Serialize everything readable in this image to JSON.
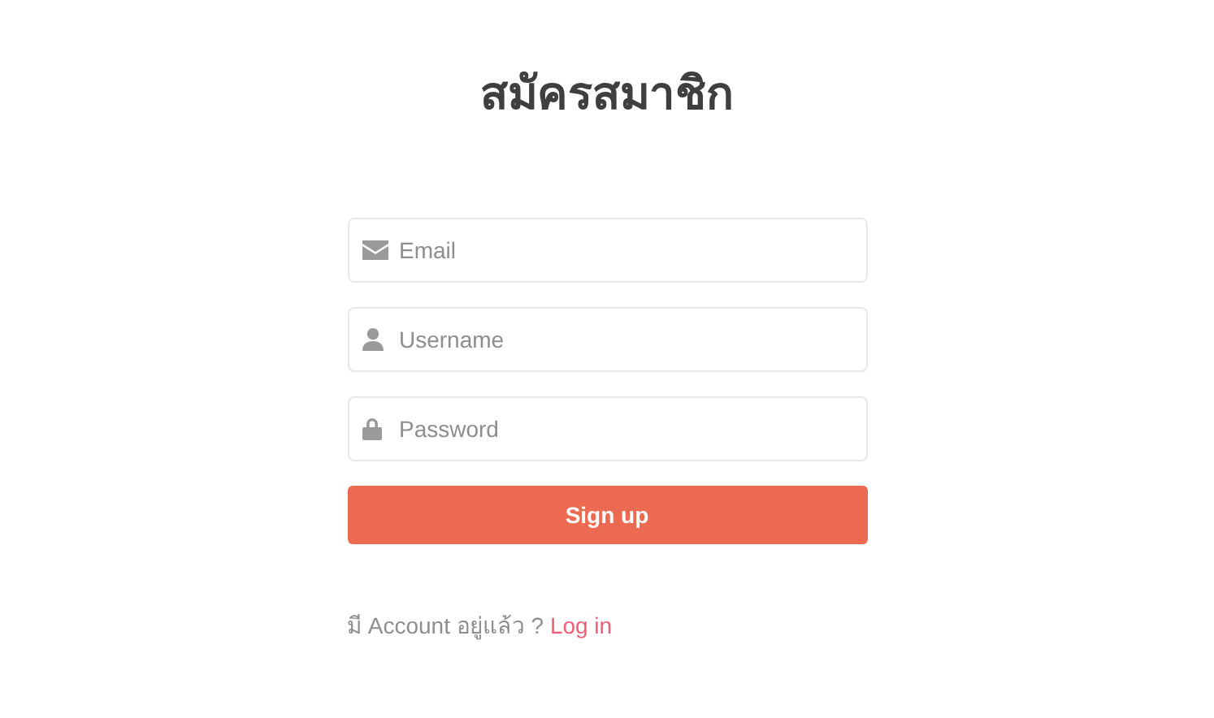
{
  "title": "สมัครสมาชิก",
  "fields": [
    {
      "kind": "email",
      "placeholder": "Email"
    },
    {
      "kind": "user",
      "placeholder": "Username"
    },
    {
      "kind": "password",
      "placeholder": "Password"
    }
  ],
  "submit": "Sign up",
  "footer": {
    "text": "มี Account อยู่แล้ว ?",
    "link": "Log in"
  }
}
